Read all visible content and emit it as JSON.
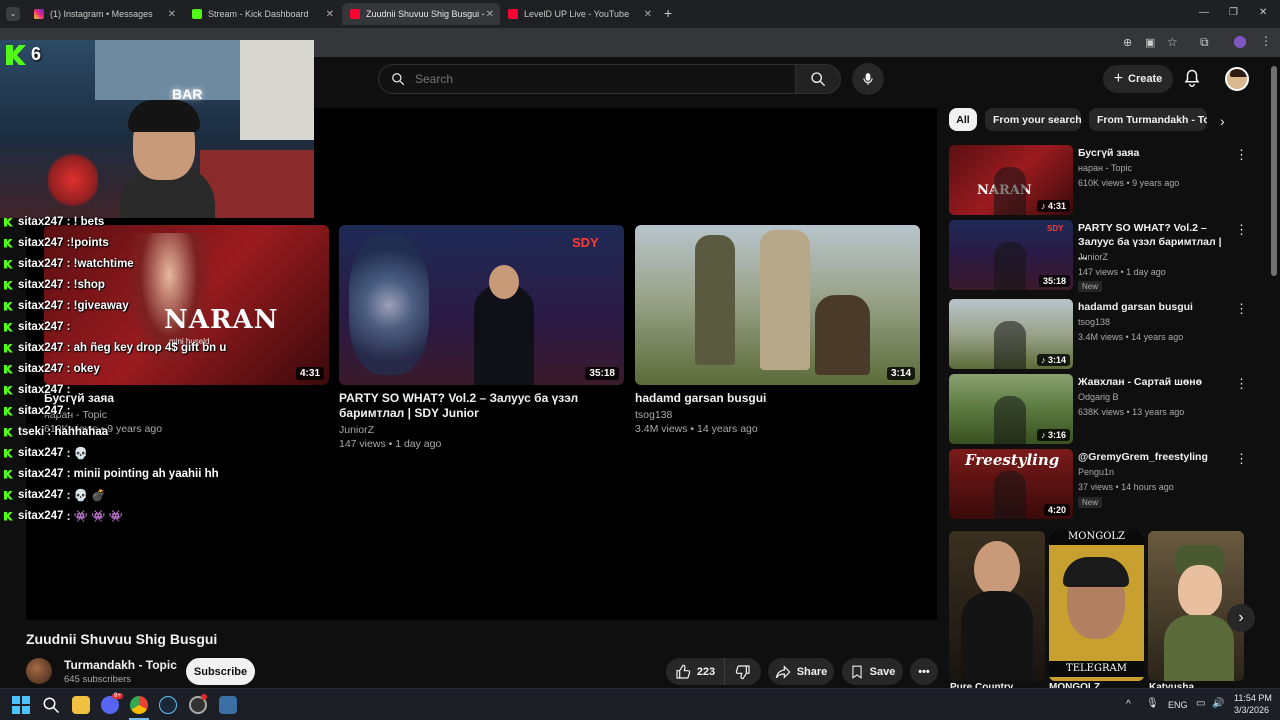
{
  "browser": {
    "tabs": [
      {
        "title": "(1) Instagram • Messages",
        "icon": "instagram-icon",
        "color": "#d6249f"
      },
      {
        "title": "Stream - Kick Dashboard",
        "icon": "kick-icon",
        "color": "#53fc18"
      },
      {
        "title": "Zuudnii Shuvuu Shig Busgui - Y",
        "icon": "youtube-icon",
        "color": "#ff0033"
      },
      {
        "title": "LevelD UP Live - YouTube",
        "icon": "youtube-icon",
        "color": "#ff0033"
      }
    ],
    "new_tab": "+"
  },
  "overlay": {
    "viewer_count": "6",
    "cam_sign": "BAR",
    "chat": [
      {
        "user": "sitax247",
        "text": " : ! bets"
      },
      {
        "user": "sitax247",
        "text": " :!points"
      },
      {
        "user": "sitax247",
        "text": " : !watchtime"
      },
      {
        "user": "sitax247",
        "text": " : !shop"
      },
      {
        "user": "sitax247",
        "text": " : !giveaway"
      },
      {
        "user": "sitax247",
        "text": " : "
      },
      {
        "user": "sitax247",
        "text": " : ah ñeg key drop 4$ gift bn u"
      },
      {
        "user": "sitax247",
        "text": " : okey"
      },
      {
        "user": "sitax247",
        "text": " : "
      },
      {
        "user": "sitax247",
        "text": " : "
      },
      {
        "user": "tseki",
        "text": " : hahhahaa"
      },
      {
        "user": "sitax247",
        "text": " : 💀"
      },
      {
        "user": "sitax247",
        "text": " : minii pointing ah yaahii hh"
      },
      {
        "user": "sitax247",
        "text": " : 💀 💣"
      },
      {
        "user": "sitax247",
        "text": " : 👾 👾 👾"
      }
    ]
  },
  "youtube": {
    "search": {
      "placeholder": "Search"
    },
    "create_label": "Create",
    "chips": [
      "All",
      "From your search",
      "From Turmandakh - Top"
    ],
    "end_screen": [
      {
        "title": "Бусгүй заяа",
        "channel": "наран - Topic",
        "meta": "610K views • 9 years ago",
        "duration": "4:31",
        "thumb_text": "NARAN",
        "thumb_sub": "mini huseld"
      },
      {
        "title": "PARTY SO WHAT? Vol.2 – Залуус ба үзэл баримтлал | SDY Junior",
        "channel": "JuniorZ",
        "meta": "147 views • 1 day ago",
        "duration": "35:18",
        "thumb_text": "SDY"
      },
      {
        "title": "hadamd garsan busgui",
        "channel": "tsog138",
        "meta": "3.4M views • 14 years ago",
        "duration": "3:14"
      }
    ],
    "video": {
      "title": "Zuudnii Shuvuu Shig Busgui",
      "channel": "Turmandakh - Topic",
      "subscribers": "645 subscribers",
      "subscribe_label": "Subscribe",
      "likes": "223",
      "share_label": "Share",
      "save_label": "Save"
    },
    "recommendations": [
      {
        "title": "Бусгүй заяа",
        "channel": "наран - Topic",
        "meta": "610K views • 9 years ago",
        "duration": "4:31",
        "music": true,
        "new": "",
        "thumb_text": "NARAN"
      },
      {
        "title": "PARTY SO WHAT? Vol.2 – Залуус ба үзэл баримтлал | ...",
        "channel": "JuniorZ",
        "meta": "147 views • 1 day ago",
        "duration": "35:18",
        "music": false,
        "new": "New",
        "thumb_text": "SDY"
      },
      {
        "title": "hadamd garsan busgui",
        "channel": "tsog138",
        "meta": "3.4M views • 14 years ago",
        "duration": "3:14",
        "music": true,
        "new": "",
        "thumb_text": ""
      },
      {
        "title": "Жавхлан - Сартай шөнө",
        "channel": "Odgarig B",
        "meta": "638K views • 13 years ago",
        "duration": "3:16",
        "music": true,
        "new": "",
        "thumb_text": ""
      },
      {
        "title": "@GremyGrem_freestyling",
        "channel": "Pengu1n",
        "meta": "37 views • 14 hours ago",
        "duration": "4:20",
        "music": false,
        "new": "New",
        "thumb_text": "Freestyling"
      }
    ],
    "shorts": [
      {
        "title": "Pure Country",
        "caption": ""
      },
      {
        "title": "MONGOLZ",
        "caption": "MONGOLZ",
        "bottom_caption": "TELEGRAM"
      },
      {
        "title": "Katyusha",
        "caption": ""
      }
    ]
  },
  "taskbar": {
    "language": "ENG",
    "time": "11:54 PM",
    "date": "3/3/2026",
    "discord_badge": "9+"
  }
}
